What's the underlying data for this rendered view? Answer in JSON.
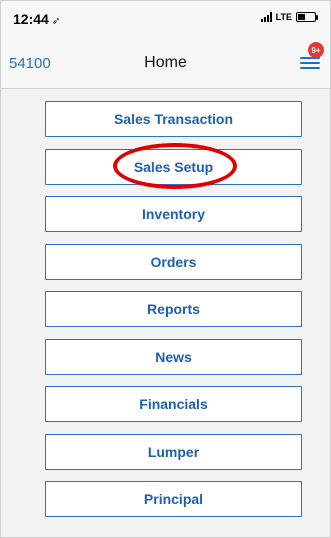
{
  "status_bar": {
    "time": "12:44",
    "location_icon": "location-arrow-icon",
    "network": "LTE"
  },
  "nav": {
    "left_label": "54100",
    "title": "Home",
    "badge": "9+"
  },
  "menu": {
    "items": [
      {
        "label": "Sales Transaction"
      },
      {
        "label": "Sales Setup"
      },
      {
        "label": "Inventory"
      },
      {
        "label": "Orders"
      },
      {
        "label": "Reports"
      },
      {
        "label": "News"
      },
      {
        "label": "Financials"
      },
      {
        "label": "Lumper"
      },
      {
        "label": "Principal"
      }
    ],
    "highlighted_index": 1
  },
  "colors": {
    "accent": "#1e73be",
    "button_text": "#1e5fae",
    "button_border": "#2a72c8",
    "highlight": "#e00000",
    "badge": "#e53935",
    "background": "#f2f2f2"
  }
}
